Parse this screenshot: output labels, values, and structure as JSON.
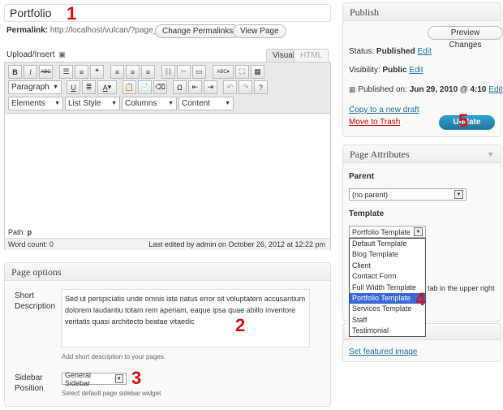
{
  "title": {
    "value": "Portfolio"
  },
  "permalink": {
    "label": "Permalink:",
    "url": "http://localhost/vulcan/?page_id=64",
    "change_label": "Change Permalinks",
    "view_label": "View Page"
  },
  "upload": {
    "label": "Upload/Insert"
  },
  "editor_tabs": {
    "visual": "Visual",
    "html": "HTML"
  },
  "toolbar": {
    "format_select": "Paragraph",
    "row3": [
      "Elements",
      "List Style",
      "Columns",
      "Content"
    ]
  },
  "editor": {
    "path": "Path:",
    "path_value": "p",
    "word_count": "Word count: 0",
    "last_edited": "Last edited by admin on October 26, 2012 at 12:22 pm"
  },
  "page_options": {
    "title": "Page options",
    "short_desc_label": "Short\nDescription",
    "short_desc_value": "Sed ut perspiciatis unde omnis iste natus error sit voluptatem accusantium dolorem laudantiu totam rem aperiam, eaque ipsa quae abillo inventore veritatis quasi architecto beatae vitaedic",
    "short_desc_hint": "Add short description to your pages.",
    "sidebar_label": "Sidebar\nPosition",
    "sidebar_value": "General Sidebar",
    "sidebar_hint": "Select default page sidebar widget"
  },
  "publish": {
    "title": "Publish",
    "preview_label": "Preview Changes",
    "status_label": "Status:",
    "status_value": "Published",
    "status_edit": "Edit",
    "visibility_label": "Visibility:",
    "visibility_value": "Public",
    "visibility_edit": "Edit",
    "published_label": "Published on:",
    "published_value": "Jun 29, 2010 @ 4:10",
    "published_edit": "Edit",
    "copy_draft": "Copy to a new draft",
    "trash": "Move to Trash",
    "update_label": "Update"
  },
  "page_attributes": {
    "title": "Page Attributes",
    "parent_label": "Parent",
    "parent_value": "(no parent)",
    "template_label": "Template",
    "template_value": "Portfolio Template",
    "template_options": [
      "Default Template",
      "Blog Template",
      "Client",
      "Contact Form",
      "Full Width Template",
      "Portfolio Template",
      "Services Template",
      "Staff",
      "Testimonial"
    ],
    "hidden_text": "tab in the upper right"
  },
  "featured": {
    "link": "Set featured image"
  },
  "annotations": [
    "1",
    "2",
    "3",
    "4",
    "5"
  ],
  "colors": {
    "accent": "#21759b",
    "annotation": "#dd1111",
    "trash": "#bc0b0b",
    "highlight": "#3a6ad4"
  }
}
